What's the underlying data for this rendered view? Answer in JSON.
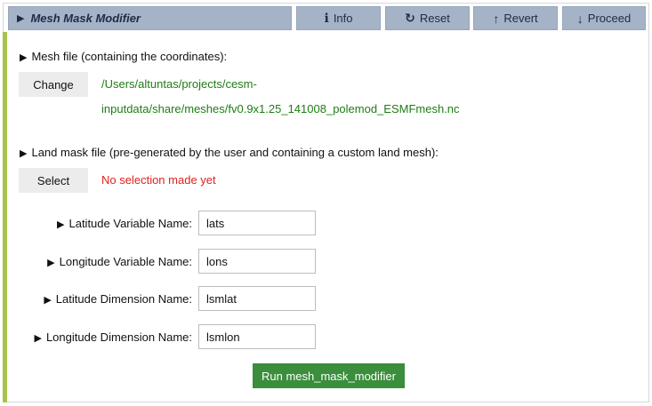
{
  "header": {
    "title": "Mesh Mask Modifier",
    "buttons": {
      "info": "Info",
      "reset": "Reset",
      "revert": "Revert",
      "proceed": "Proceed"
    }
  },
  "mesh_file": {
    "label": "Mesh file (containing the coordinates):",
    "button": "Change",
    "path_line1": "/Users/altuntas/projects/cesm-",
    "path_line2": "inputdata/share/meshes/fv0.9x1.25_141008_polemod_ESMFmesh.nc"
  },
  "land_mask": {
    "label": "Land mask file (pre-generated by the user and containing a custom land mesh):",
    "button": "Select",
    "status": "No selection made yet"
  },
  "fields": [
    {
      "label": "Latitude Variable Name:",
      "value": "lats"
    },
    {
      "label": "Longitude Variable Name:",
      "value": "lons"
    },
    {
      "label": "Latitude Dimension Name:",
      "value": "lsmlat"
    },
    {
      "label": "Longitude Dimension Name:",
      "value": "lsmlon"
    }
  ],
  "run_button": "Run mesh_mask_modifier",
  "colors": {
    "header_bg": "#a5b3c7",
    "accent": "#a7c44a",
    "path_text": "#1e7d14",
    "warning_text": "#e0211d",
    "run_button": "#3a8e3c"
  },
  "icons": {
    "title": "triangle-right-icon",
    "info": "info-icon",
    "reset": "reset-icon",
    "revert": "arrow-up-icon",
    "proceed": "arrow-down-icon"
  }
}
